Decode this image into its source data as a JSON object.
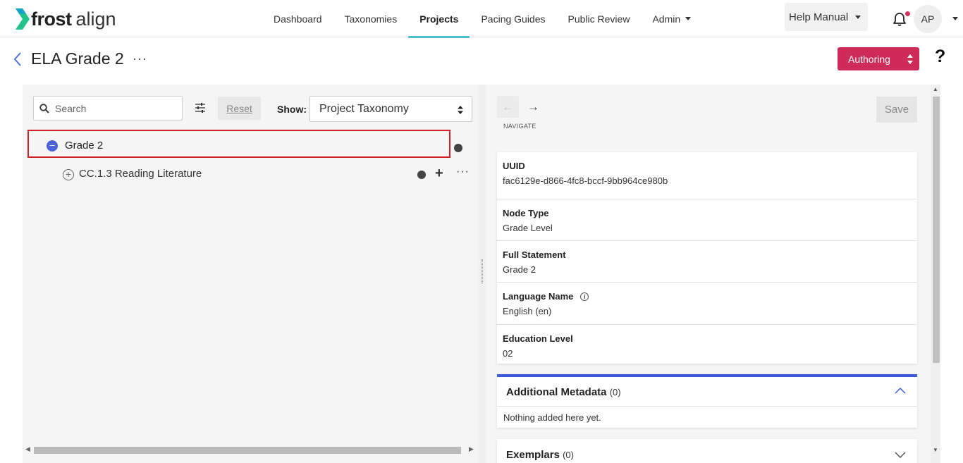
{
  "brand": {
    "name_bold": "frost",
    "name_light": "align"
  },
  "nav": {
    "items": [
      {
        "label": "Dashboard"
      },
      {
        "label": "Taxonomies"
      },
      {
        "label": "Projects"
      },
      {
        "label": "Pacing Guides"
      },
      {
        "label": "Public Review"
      },
      {
        "label": "Admin"
      }
    ],
    "active": "Projects",
    "help_label": "Help Manual",
    "avatar_initials": "AP"
  },
  "titlebar": {
    "title": "ELA Grade 2",
    "more": "···",
    "mode_label": "Authoring",
    "help_symbol": "?"
  },
  "left": {
    "search_placeholder": "Search",
    "reset_label": "Reset",
    "show_label": "Show:",
    "show_value": "Project Taxonomy",
    "tree": [
      {
        "label": "Grade 2",
        "expanded": true,
        "selected": true
      },
      {
        "label": "CC.1.3 Reading Literature",
        "expanded": false
      }
    ]
  },
  "right": {
    "navigate_label": "NAVIGATE",
    "save_label": "Save",
    "fields": [
      {
        "label": "UUID",
        "value": "fac6129e-d866-4fc8-bccf-9bb964ce980b"
      },
      {
        "label": "Node Type",
        "value": "Grade Level"
      },
      {
        "label": "Full Statement",
        "value": "Grade 2"
      },
      {
        "label": "Language Name",
        "value": "English (en)"
      },
      {
        "label": "Education Level",
        "value": "02"
      }
    ],
    "metadata": {
      "title": "Additional Metadata",
      "count": "(0)",
      "empty_text": "Nothing added here yet."
    },
    "exemplars": {
      "title": "Exemplars",
      "count": "(0)"
    }
  },
  "colors": {
    "accent": "#cf2b58",
    "nav_underline": "#4cc0d1",
    "selection_border": "#d21f2a",
    "section_top": "#3b5bdb",
    "node_icon": "#4a63d9"
  }
}
